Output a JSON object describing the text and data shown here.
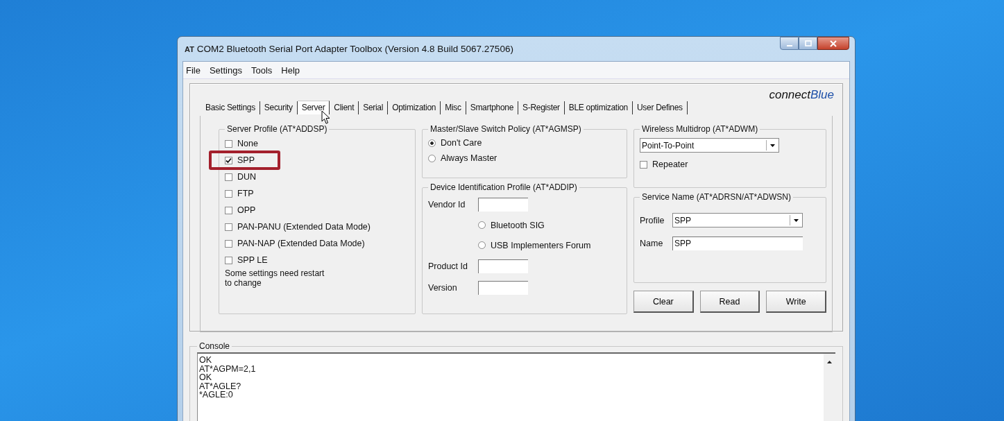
{
  "window": {
    "app_icon": "AT",
    "title": "COM2 Bluetooth Serial Port Adapter Toolbox (Version 4.8 Build 5067.27506)"
  },
  "menu": [
    "File",
    "Settings",
    "Tools",
    "Help"
  ],
  "brand": [
    "connect",
    "Blue"
  ],
  "tabs": [
    {
      "label": "Basic Settings",
      "selected": false
    },
    {
      "label": "Security",
      "selected": false
    },
    {
      "label": "Server",
      "selected": true
    },
    {
      "label": "Client",
      "selected": false
    },
    {
      "label": "Serial",
      "selected": false
    },
    {
      "label": "Optimization",
      "selected": false
    },
    {
      "label": "Misc",
      "selected": false
    },
    {
      "label": "Smartphone",
      "selected": false
    },
    {
      "label": "S-Register",
      "selected": false
    },
    {
      "label": "BLE optimization",
      "selected": false
    },
    {
      "label": "User Defines",
      "selected": false
    }
  ],
  "server_profile": {
    "title": "Server Profile (AT*ADDSP)",
    "options": [
      {
        "label": "None",
        "checked": false
      },
      {
        "label": "SPP",
        "checked": true
      },
      {
        "label": "DUN",
        "checked": false
      },
      {
        "label": "FTP",
        "checked": false
      },
      {
        "label": "OPP",
        "checked": false
      },
      {
        "label": "PAN-PANU (Extended Data Mode)",
        "checked": false
      },
      {
        "label": "PAN-NAP (Extended Data Mode)",
        "checked": false
      },
      {
        "label": "SPP LE",
        "checked": false
      }
    ],
    "note": [
      "Some settings need restart",
      "to change"
    ]
  },
  "master_slave": {
    "title": "Master/Slave Switch Policy (AT*AGMSP)",
    "options": [
      {
        "label": "Don't Care",
        "selected": true
      },
      {
        "label": "Always Master",
        "selected": false
      }
    ]
  },
  "device_id": {
    "title": "Device Identification Profile (AT*ADDIP)",
    "vendor_label": "Vendor Id",
    "sources": [
      {
        "label": "Bluetooth SIG",
        "selected": false
      },
      {
        "label": "USB Implementers Forum",
        "selected": false
      }
    ],
    "product_label": "Product Id",
    "version_label": "Version"
  },
  "wireless": {
    "title": "Wireless Multidrop (AT*ADWM)",
    "mode": "Point-To-Point",
    "repeater": {
      "label": "Repeater",
      "checked": false
    }
  },
  "service_name": {
    "title": "Service Name (AT*ADRSN/AT*ADWSN)",
    "profile": {
      "label": "Profile",
      "value": "SPP"
    },
    "name": {
      "label": "Name",
      "value": "SPP"
    }
  },
  "buttons": [
    "Clear",
    "Read",
    "Write"
  ],
  "console": {
    "title": "Console",
    "lines": [
      "OK",
      "AT*AGPM=2,1",
      "OK",
      "AT*AGLE?",
      "*AGLE:0"
    ]
  }
}
